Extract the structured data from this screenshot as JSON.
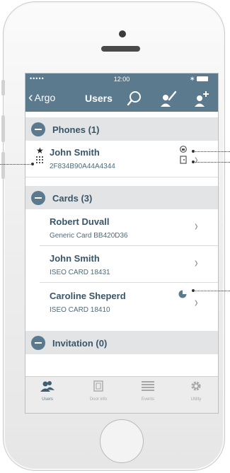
{
  "status_bar": {
    "signal": "•••••",
    "time": "12:00",
    "bluetooth": "∗"
  },
  "nav": {
    "back_label": "Argo",
    "title": "Users"
  },
  "sections": {
    "phones": {
      "label": "Phones (1)"
    },
    "cards": {
      "label": "Cards (3)"
    },
    "invitation": {
      "label": "Invitation (0)"
    }
  },
  "phones": [
    {
      "name": "John Smith",
      "id": "2F834B90A44A4344"
    }
  ],
  "cards": [
    {
      "name": "Robert Duvall",
      "detail": "Generic Card BB420D36"
    },
    {
      "name": "John Smith",
      "detail": "ISEO CARD 18431"
    },
    {
      "name": "Caroline Sheperd",
      "detail": "ISEO CARD 18410"
    }
  ],
  "tabs": [
    {
      "label": "Users",
      "icon": "users-icon",
      "active": true
    },
    {
      "label": "Door info",
      "icon": "door-icon",
      "active": false
    },
    {
      "label": "Events",
      "icon": "list-icon",
      "active": false
    },
    {
      "label": "Utility",
      "icon": "gear-icon",
      "active": false
    }
  ],
  "colors": {
    "accent": "#5b7a8d",
    "section_bg": "#e3e4e5",
    "text": "#3a5567"
  }
}
